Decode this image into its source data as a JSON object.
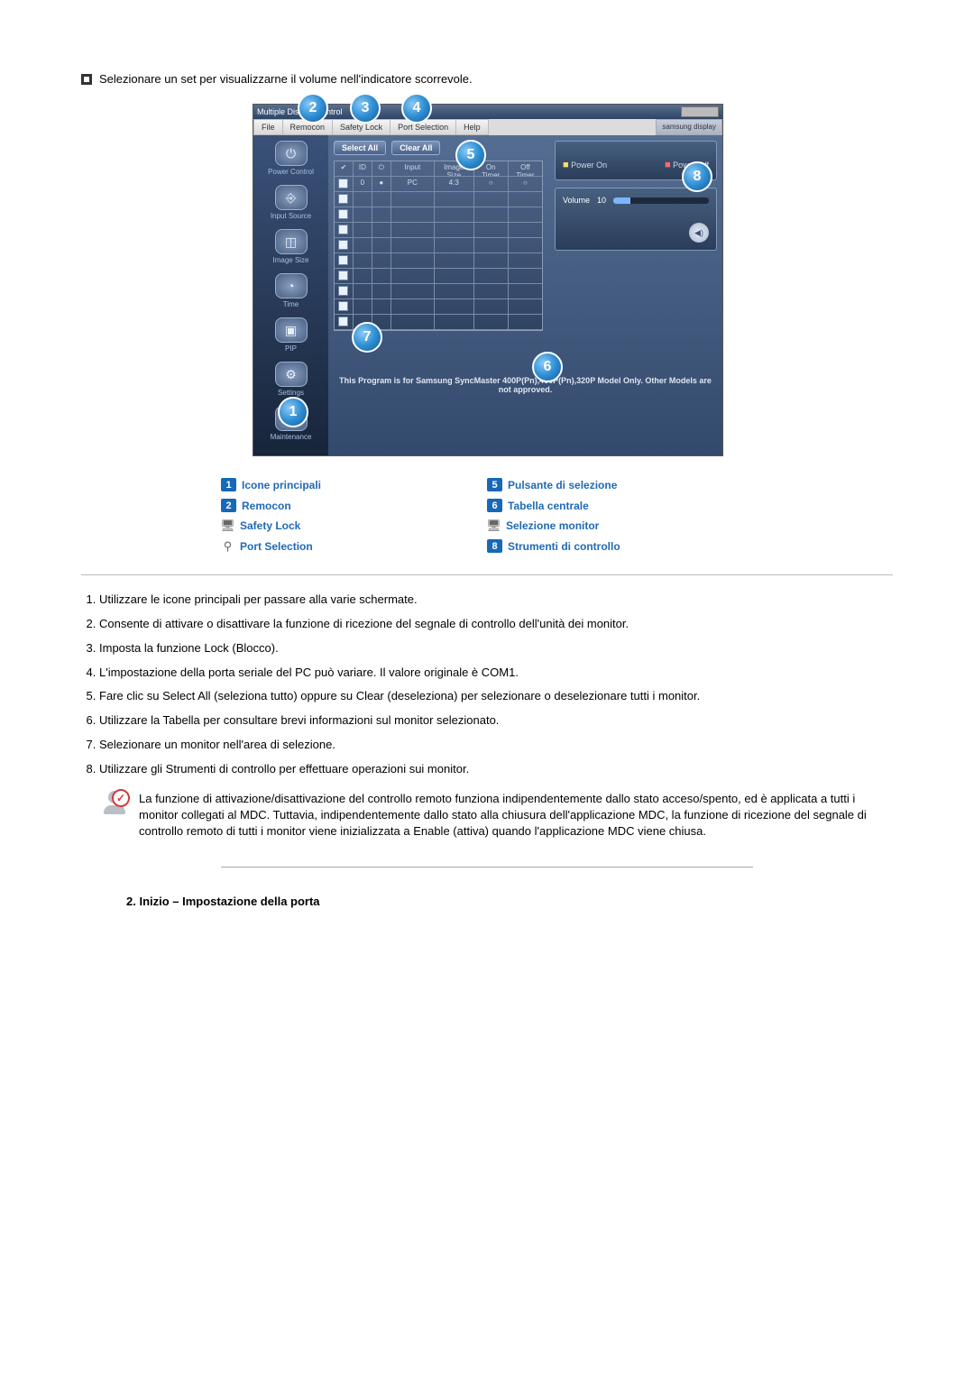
{
  "intro": "Selezionare un set per visualizzarne il volume nell'indicatore scorrevole.",
  "app": {
    "title": "Multiple Display Control",
    "menus": {
      "file": "File",
      "remocon": "Remocon",
      "safety": "Safety Lock",
      "port": "Port Selection",
      "help": "Help",
      "status": "samsung display"
    },
    "sidebar": {
      "power": "Power Control",
      "input": "Input Source",
      "image": "Image Size",
      "time": "Time",
      "pip": "PIP",
      "settings": "Settings",
      "maintenance": "Maintenance"
    },
    "buttons": {
      "select_all": "Select All",
      "clear_all": "Clear All"
    },
    "grid": {
      "h_chk": "✔",
      "h_id": "ID",
      "h_pm": "⏻",
      "h_input": "Input",
      "h_img": "Image Size",
      "h_ont": "On Timer",
      "h_oft": "Off Timer",
      "rows": [
        {
          "id": "0",
          "input": "PC",
          "img": "4:3",
          "on": "○",
          "off": "○"
        }
      ]
    },
    "power": {
      "on": "Power On",
      "off": "Power Off"
    },
    "volume": {
      "label": "Volume",
      "value": "10"
    },
    "bottom_note": "This Program is for Samsung SyncMaster 400P(Pn),460P(Pn),320P  Model Only. Other Models are not approved."
  },
  "callouts": {
    "c1": "1",
    "c2": "2",
    "c3": "3",
    "c4": "4",
    "c5": "5",
    "c6": "6",
    "c7": "7",
    "c8": "8"
  },
  "legend": {
    "l1": "Icone principali",
    "l2": "Remocon",
    "l3": "Safety Lock",
    "l4": "Port Selection",
    "l5": "Pulsante di selezione",
    "l6": "Tabella centrale",
    "l7": "Selezione monitor",
    "l8": "Strumenti di controllo"
  },
  "steps": {
    "s1": "Utilizzare le icone principali per passare alla varie schermate.",
    "s2": "Consente di attivare o disattivare la funzione di ricezione del segnale di controllo dell'unità dei monitor.",
    "s3": "Imposta la funzione Lock (Blocco).",
    "s4": "L'impostazione della porta seriale del PC può variare. Il valore originale è COM1.",
    "s5": "Fare clic su Select All (seleziona tutto) oppure su Clear (deseleziona) per selezionare o deselezionare tutti i monitor.",
    "s6": "Utilizzare la Tabella per consultare brevi informazioni sul monitor selezionato.",
    "s7": "Selezionare un monitor nell'area di selezione.",
    "s8": "Utilizzare gli Strumenti di controllo per effettuare operazioni sui monitor."
  },
  "note": "La funzione di attivazione/disattivazione del controllo remoto funziona indipendentemente dallo stato acceso/spento, ed è applicata a tutti i monitor collegati al MDC. Tuttavia, indipendentemente dallo stato alla chiusura dell'applicazione MDC, la funzione di ricezione del segnale di controllo remoto di tutti i monitor viene inizializzata a Enable (attiva) quando l'applicazione MDC viene chiusa.",
  "section2": "2. Inizio – Impostazione della porta"
}
